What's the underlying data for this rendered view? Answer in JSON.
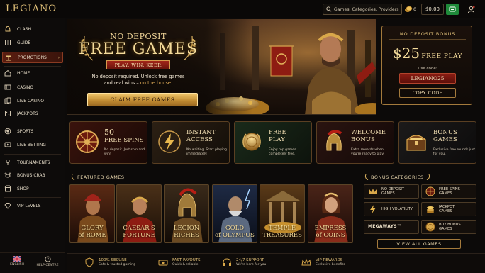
{
  "header": {
    "logo": "LEGIANO",
    "search_placeholder": "Games, Categories, Providers",
    "coins": "0",
    "balance": "$0.00"
  },
  "sidebar": {
    "items": [
      {
        "label": "CLASH"
      },
      {
        "label": "GUIDE"
      },
      {
        "label": "PROMOTIONS"
      },
      {
        "label": "HOME"
      },
      {
        "label": "CASINO"
      },
      {
        "label": "LIVE CASINO"
      },
      {
        "label": "JACKPOTS"
      },
      {
        "label": "SPORTS"
      },
      {
        "label": "LIVE BETTING"
      },
      {
        "label": "TOURNAMENTS"
      },
      {
        "label": "BONUS CRAB"
      },
      {
        "label": "SHOP"
      },
      {
        "label": "VIP LEVELS"
      }
    ],
    "english_label": "ENGLISH",
    "help_label": "HELP CENTRE"
  },
  "hero": {
    "no_deposit": "NO DEPOSIT",
    "free_games": "FREE GAMES",
    "ribbon": "PLAY. WIN. KEEP.",
    "desc_line1": "No deposit required. Unlock free games",
    "desc_line2_a": "and real wins – ",
    "desc_line2_b": "on the house!",
    "claim_button": "CLAIM FREE GAMES"
  },
  "bonus_panel": {
    "title": "NO DEPOSIT BONUS",
    "amount": "$25",
    "amount_suffix": "FREE PLAY",
    "use_code": "Use code:",
    "code": "LEGIANO25",
    "copy_button": "COPY CODE"
  },
  "cards": [
    {
      "title1": "50",
      "title2": "FREE SPINS",
      "sub": "No deposit. Just spin and win!"
    },
    {
      "title1": "INSTANT",
      "title2": "ACCESS",
      "sub": "No waiting. Start playing immediately."
    },
    {
      "title1": "FREE",
      "title2": "PLAY",
      "sub": "Enjoy top games completely free."
    },
    {
      "title1": "WELCOME",
      "title2": "BONUS",
      "sub": "Extra rewards when you're ready to play."
    },
    {
      "title1": "BONUS",
      "title2": "GAMES",
      "sub": "Exclusive free rounds just for you."
    }
  ],
  "featured": {
    "heading": "FEATURED GAMES",
    "games": [
      {
        "line1": "GLORY",
        "line2": "of ROME"
      },
      {
        "line1": "CAESAR'S",
        "line2": "FORTUNE"
      },
      {
        "line1": "LEGION",
        "line2": "RICHES"
      },
      {
        "line1": "GOLD",
        "line2": "of OLYMPUS"
      },
      {
        "line1": "TEMPLE",
        "line2": "TREASURES"
      },
      {
        "line1": "EMPRESS",
        "line2": "of COINS"
      }
    ]
  },
  "categories": {
    "heading": "BONUS CATEGORIES",
    "items": [
      {
        "line1": "NO DEPOSIT",
        "line2": "GAMES"
      },
      {
        "line1": "FREE SPINS",
        "line2": "GAMES"
      },
      {
        "line1": "HIGH VOLATILITY",
        "line2": ""
      },
      {
        "line1": "JACKPOT",
        "line2": "GAMES"
      },
      {
        "line1": "MEGAWAYS™",
        "line2": ""
      },
      {
        "line1": "BUY BONUS",
        "line2": "GAMES"
      }
    ],
    "view_all": "VIEW ALL GAMES"
  },
  "footer": [
    {
      "title": "100% SECURE",
      "sub": "Safe & trusted gaming"
    },
    {
      "title": "FAST PAYOUTS",
      "sub": "Quick & reliable"
    },
    {
      "title": "24/7 SUPPORT",
      "sub": "We're here for you"
    },
    {
      "title": "VIP REWARDS",
      "sub": "Exclusive benefits"
    }
  ]
}
